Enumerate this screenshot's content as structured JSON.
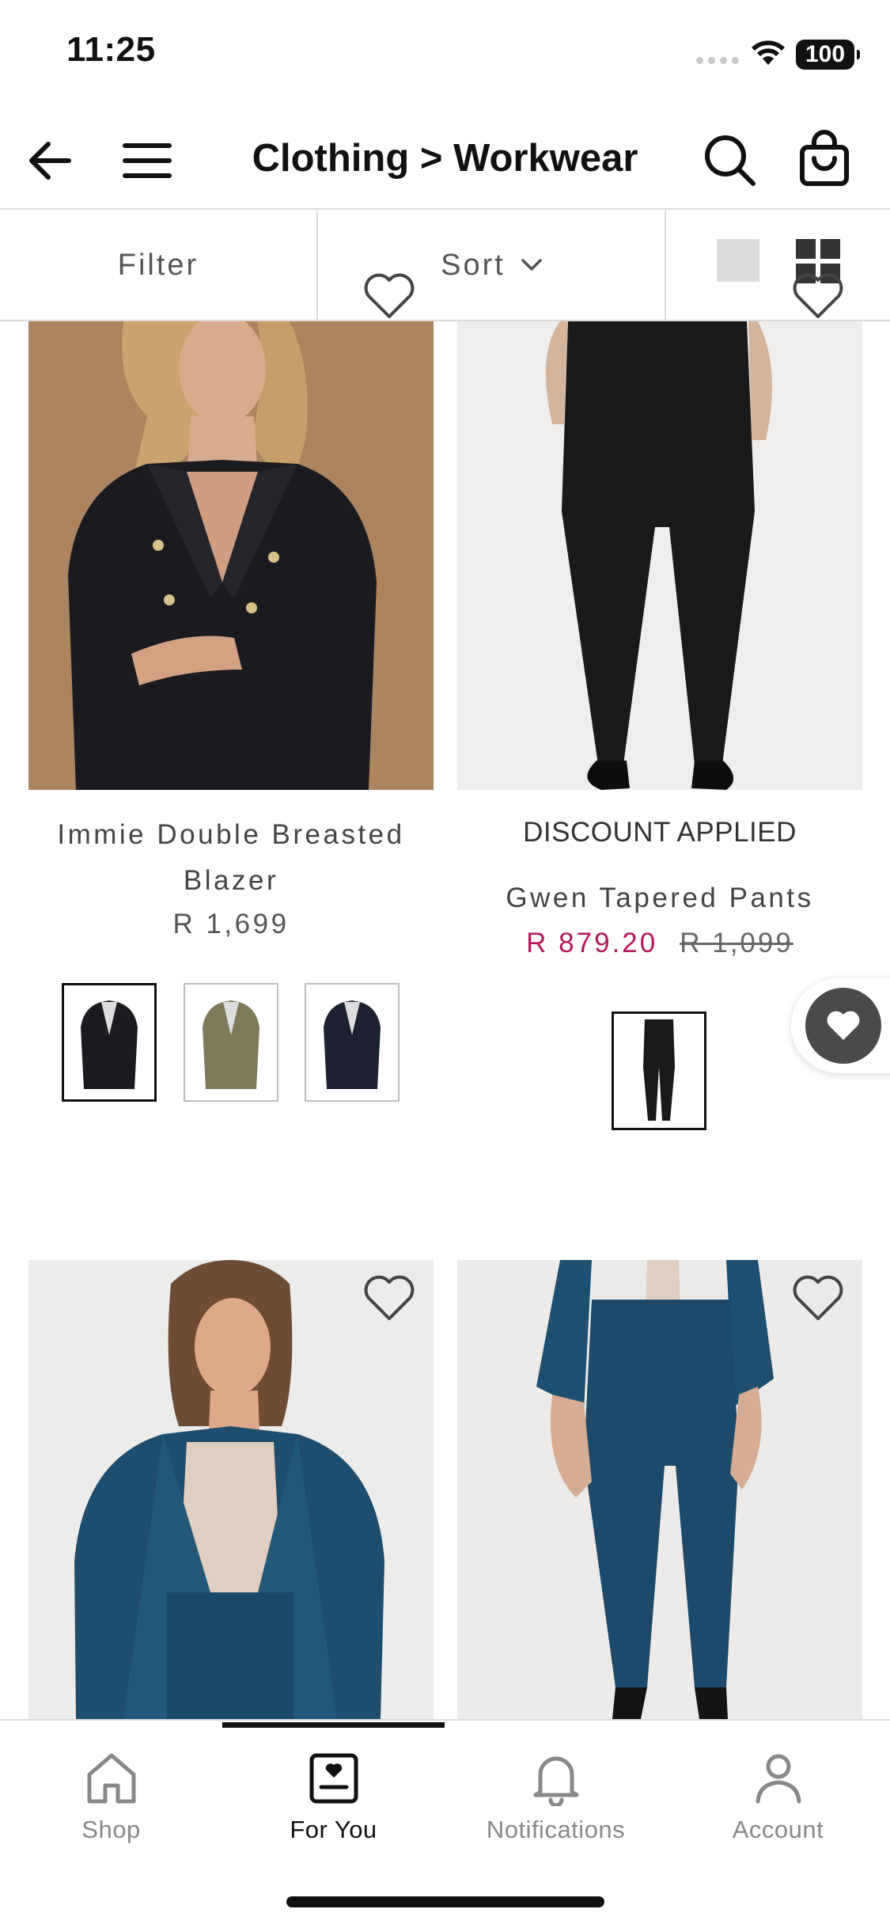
{
  "status_bar": {
    "time": "11:25",
    "battery": "100"
  },
  "nav": {
    "title": "Clothing > Workwear"
  },
  "filter_bar": {
    "filter_label": "Filter",
    "sort_label": "Sort"
  },
  "products": [
    {
      "name": "Immie Double Breasted Blazer",
      "price": "R 1,699",
      "swatch_colors": [
        "black",
        "khaki",
        "navy"
      ]
    },
    {
      "badge": "DISCOUNT APPLIED",
      "name": "Gwen Tapered Pants",
      "sale_price": "R 879.20",
      "original_price": "R 1,099",
      "swatch_colors": [
        "black"
      ]
    },
    {
      "name": "",
      "price": ""
    },
    {
      "name": "",
      "price": ""
    }
  ],
  "tab_bar": {
    "tabs": [
      {
        "label": "Shop",
        "icon": "home-icon"
      },
      {
        "label": "For You",
        "icon": "heart-card-icon",
        "active": true
      },
      {
        "label": "Notifications",
        "icon": "bell-icon"
      },
      {
        "label": "Account",
        "icon": "person-icon"
      }
    ]
  },
  "colors": {
    "sale_price": "#b5185a",
    "accent_dark": "#111111",
    "divider": "#dcdcdc"
  }
}
